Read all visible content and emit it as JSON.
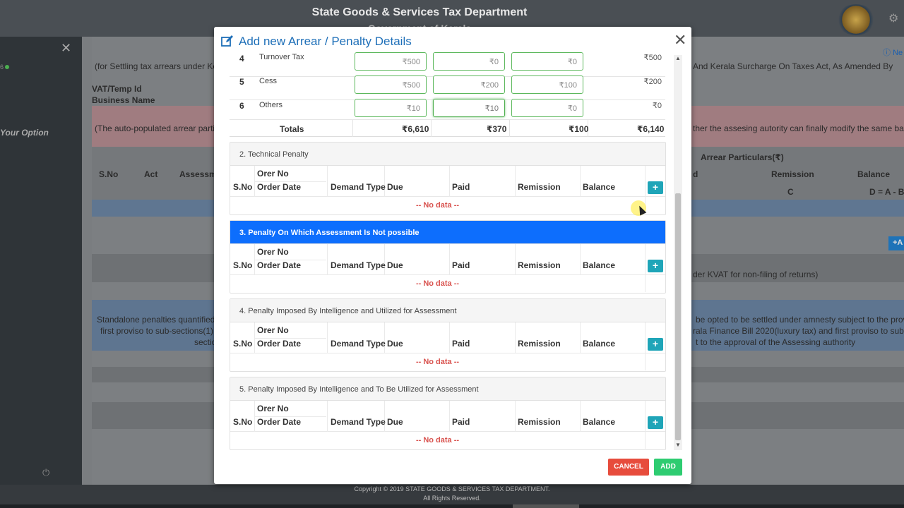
{
  "app": {
    "title": "State Goods & Services Tax Department",
    "subtitle": "Government of Kerala",
    "footer_line1": "Copyright © 2019 STATE GOODS & SERVICES TAX DEPARTMENT.",
    "footer_line2": "All Rights Reserved."
  },
  "sidebar": {
    "status_text": "6",
    "option_label": "Your Option"
  },
  "background": {
    "intro_text": "(for Settling tax arrears under Kera",
    "intro_text_right": "And Kerala Surcharge On Taxes Act, As Amended By",
    "vat_label": "VAT/Temp Id",
    "business_label": "Business Name",
    "auto_text": "(The auto-populated arrear partic",
    "auto_text_right": "ther the assesing autority can finally modify the same based",
    "col_sno": "S.No",
    "col_act": "Act",
    "col_assess": "Assessm",
    "arrear_particulars": "Arrear Particulars(₹)",
    "col_d": "d",
    "col_remission": "Remission",
    "col_balance": "Balance",
    "col_c": "C",
    "col_formula": "D = A - B",
    "kvat_text": "der KVAT for non-filing of returns)",
    "standalone_1": "Standalone penalties quantified o",
    "standalone_2": "first proviso to sub-sections(1) o",
    "standalone_3": "sectio",
    "standalone_r1": "be opted to be settled under amnesty subject to the provisi",
    "standalone_r2": "rala Finance Bill 2020(luxury tax) and first proviso to sub-secti",
    "standalone_r3": "t to the approval of the Assessing authority",
    "info_label": "Ne",
    "add_label": "+A"
  },
  "modal": {
    "title": "Add new Arrear / Penalty Details",
    "arrear_rows": [
      {
        "sno": "4",
        "name": "Turnover Tax",
        "due": "₹500",
        "paid": "₹0",
        "remission": "₹0",
        "balance": "₹500"
      },
      {
        "sno": "5",
        "name": "Cess",
        "due": "₹500",
        "paid": "₹200",
        "remission": "₹100",
        "balance": "₹200"
      },
      {
        "sno": "6",
        "name": "Others",
        "due": "₹10",
        "paid": "₹10",
        "remission": "₹0",
        "balance": "₹0"
      }
    ],
    "totals": {
      "label": "Totals",
      "due": "₹6,610",
      "paid": "₹370",
      "remission": "₹100",
      "balance": "₹6,140"
    },
    "table_headers": {
      "sno": "S.No",
      "order_no": "Orer No",
      "order_date": "Order Date",
      "demand_type": "Demand Type",
      "due": "Due",
      "paid": "Paid",
      "remission": "Remission",
      "balance": "Balance"
    },
    "no_data": "-- No data --",
    "sections": [
      {
        "title": "2. Technical Penalty"
      },
      {
        "title": "3. Penalty On Which Assessment Is Not possible"
      },
      {
        "title": "4. Penalty Imposed By Intelligence and Utilized for Assessment"
      },
      {
        "title": "5. Penalty Imposed By Intelligence and To Be Utilized for Assessment"
      }
    ],
    "cancel_label": "CANCEL",
    "add_label": "ADD"
  },
  "colors": {
    "accent": "#1e6fb8",
    "active_section": "#0d6efd",
    "cancel": "#e74c3c",
    "add": "#2ecc71",
    "plus": "#1fa5b8",
    "no_data": "#d9534f"
  },
  "icons": [
    "edit-icon",
    "close-icon",
    "plus-icon",
    "settings-icon",
    "power-icon",
    "info-icon",
    "emblem-logo"
  ]
}
